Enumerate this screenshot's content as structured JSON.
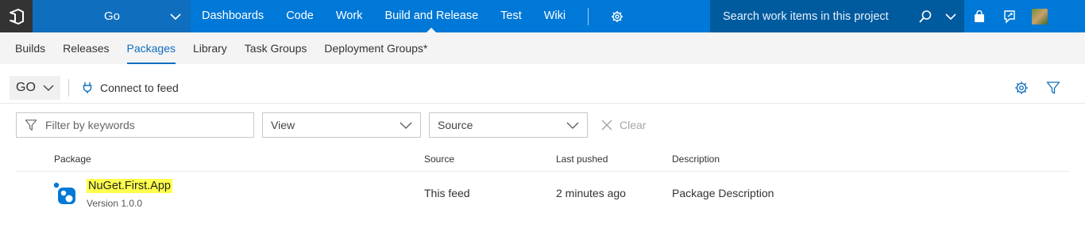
{
  "topbar": {
    "project": "Go",
    "nav": [
      "Dashboards",
      "Code",
      "Work",
      "Build and Release",
      "Test",
      "Wiki"
    ],
    "active_nav": "Build and Release",
    "search_placeholder": "Search work items in this project"
  },
  "subnav": {
    "items": [
      "Builds",
      "Releases",
      "Packages",
      "Library",
      "Task Groups",
      "Deployment Groups*"
    ],
    "active": "Packages"
  },
  "toolbar": {
    "feed": "GO",
    "connect_label": "Connect to feed"
  },
  "filters": {
    "keyword_placeholder": "Filter by keywords",
    "view_label": "View",
    "source_label": "Source",
    "clear_label": "Clear"
  },
  "table": {
    "columns": [
      "Package",
      "Source",
      "Last pushed",
      "Description"
    ],
    "rows": [
      {
        "name": "NuGet.First.App",
        "version": "Version 1.0.0",
        "source": "This feed",
        "last_pushed": "2 minutes ago",
        "description": "Package Description"
      }
    ]
  },
  "colors": {
    "topbar": "#0078d7",
    "accent": "#106ebe",
    "highlight": "#ffff4d"
  },
  "icons": [
    "vsts-logo-icon",
    "chevron-down-icon",
    "gear-icon",
    "search-icon",
    "shopping-bag-icon",
    "feedback-icon",
    "avatar",
    "plug-icon",
    "filter-icon",
    "close-icon",
    "nuget-package-icon"
  ]
}
